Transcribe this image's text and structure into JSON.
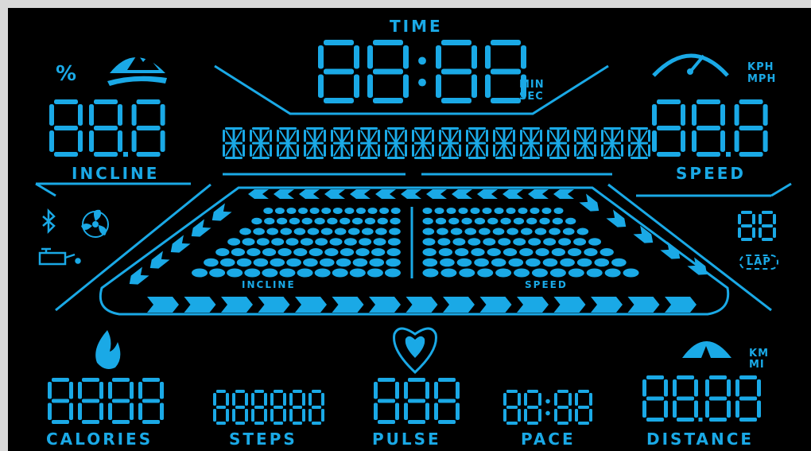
{
  "colors": {
    "accent": "#1aa9e6",
    "background": "#000000",
    "frame": "#d9d9d9"
  },
  "time": {
    "label": "TIME",
    "value": "88:88",
    "unit_top": "MIN",
    "unit_bottom": "SEC"
  },
  "incline": {
    "label": "INCLINE",
    "value": "88.8",
    "unit": "%",
    "icon": "mountain-icon"
  },
  "speed": {
    "label": "SPEED",
    "value": "88.8",
    "unit_top": "KPH",
    "unit_bottom": "MPH",
    "icon": "speedometer-icon"
  },
  "message": {
    "value": "8888888888888888",
    "char_count": 16
  },
  "lap": {
    "value": "88",
    "label": "LAP"
  },
  "status_icons": [
    "bluetooth-icon",
    "fan-icon",
    "oil-can-icon"
  ],
  "track": {
    "incline_label": "INCLINE",
    "speed_label": "SPEED",
    "dot_rows": 7,
    "dots_per_side": 12
  },
  "calories": {
    "label": "CALORIES",
    "value": "8888",
    "icon": "flame-icon"
  },
  "steps": {
    "label": "STEPS",
    "value": "888888"
  },
  "pulse": {
    "label": "PULSE",
    "value": "888",
    "icon": "heart-icon"
  },
  "pace": {
    "label": "PACE",
    "value": "88:88"
  },
  "distance": {
    "label": "DISTANCE",
    "value": "88.88",
    "unit_top": "KM",
    "unit_bottom": "MI",
    "icon": "road-icon"
  }
}
